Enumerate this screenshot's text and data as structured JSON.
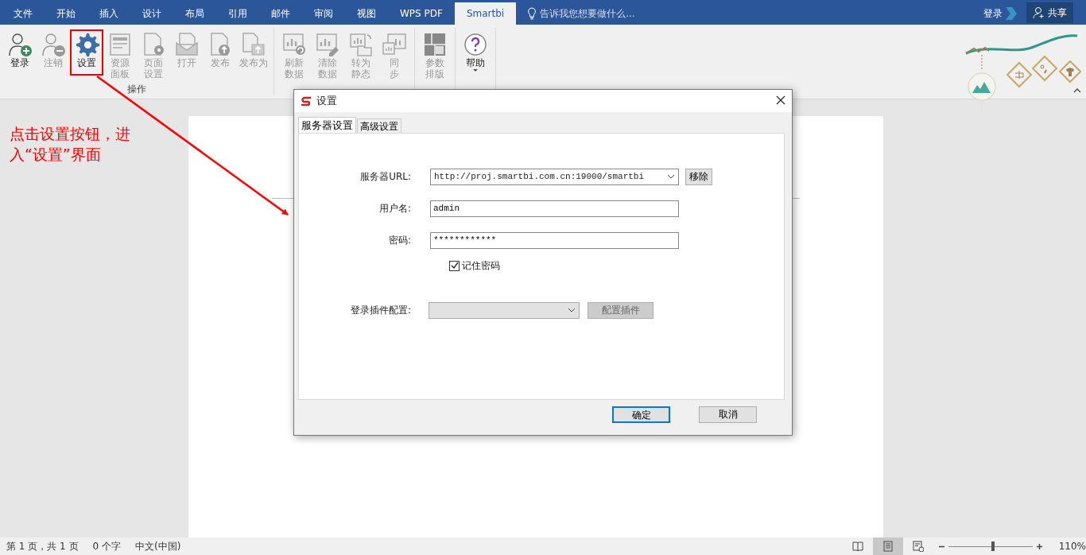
{
  "menu_tabs": [
    {
      "label": "文件",
      "selected": false
    },
    {
      "label": "开始",
      "selected": false
    },
    {
      "label": "插入",
      "selected": false
    },
    {
      "label": "设计",
      "selected": false
    },
    {
      "label": "布局",
      "selected": false
    },
    {
      "label": "引用",
      "selected": false
    },
    {
      "label": "邮件",
      "selected": false
    },
    {
      "label": "审阅",
      "selected": false
    },
    {
      "label": "视图",
      "selected": false
    },
    {
      "label": "WPS PDF",
      "selected": false
    },
    {
      "label": "Smartbi",
      "selected": true
    }
  ],
  "tell_me": {
    "placeholder": "告诉我您想要做什么..."
  },
  "account": {
    "login": "登录",
    "share": "共享"
  },
  "ribbon_groups": [
    {
      "label": "操作",
      "buttons": [
        {
          "kind": "user-add",
          "label": "登录",
          "disabled": false,
          "highlighted": false
        },
        {
          "kind": "user-remove",
          "label": "注销",
          "disabled": true,
          "highlighted": false
        },
        {
          "kind": "gear",
          "label": "设置",
          "disabled": false,
          "highlighted": true
        },
        {
          "kind": "panel",
          "label": [
            "资源",
            "面板"
          ],
          "disabled": true,
          "highlighted": false
        },
        {
          "kind": "page-gear",
          "label": [
            "页面",
            "设置"
          ],
          "disabled": true,
          "highlighted": false
        },
        {
          "kind": "envelope",
          "label": "打开",
          "disabled": true,
          "highlighted": false
        },
        {
          "kind": "upload",
          "label": "发布",
          "disabled": true,
          "highlighted": false
        },
        {
          "kind": "upload-copy",
          "label": "发布为",
          "disabled": true,
          "highlighted": false
        }
      ]
    },
    {
      "buttons": [
        {
          "kind": "chart-refresh",
          "label": [
            "刷新",
            "数据"
          ],
          "disabled": true,
          "highlighted": false
        },
        {
          "kind": "chart-erase",
          "label": [
            "清除",
            "数据"
          ],
          "disabled": true,
          "highlighted": false
        },
        {
          "kind": "chart-convert",
          "label": [
            "转为",
            "静态"
          ],
          "disabled": true,
          "highlighted": false
        },
        {
          "kind": "chart-sync",
          "label": [
            "同",
            "步"
          ],
          "disabled": true,
          "highlighted": false
        }
      ]
    },
    {
      "buttons": [
        {
          "kind": "layout",
          "label": [
            "参数",
            "排版"
          ],
          "disabled": true,
          "highlighted": false
        }
      ]
    },
    {
      "buttons": [
        {
          "kind": "help",
          "label": "帮助",
          "disabled": false,
          "highlighted": false,
          "dropdown": true
        }
      ]
    }
  ],
  "annotation": {
    "text": "点击设置按钮，进入“设置”界面"
  },
  "dialog": {
    "title": "设置",
    "tabs": [
      {
        "label": "服务器设置",
        "selected": true
      },
      {
        "label": "高级设置",
        "selected": false
      }
    ],
    "fields": [
      {
        "kind": "combo",
        "label": "服务器URL:",
        "value": "http://proj.smartbi.com.cn:19000/smartbi",
        "button": "移除",
        "disabled": false
      },
      {
        "kind": "text",
        "label": "用户名:",
        "value": "admin"
      },
      {
        "kind": "text",
        "label": "密码:",
        "value": "************"
      },
      {
        "kind": "checkbox",
        "label": "记住密码",
        "checked": true
      },
      {
        "kind": "combo",
        "label": "登录插件配置:",
        "button": "配置插件",
        "disabled": true
      }
    ],
    "buttons": [
      {
        "label": "确定",
        "default": true
      },
      {
        "label": "取消",
        "default": false
      }
    ]
  },
  "status_bar": {
    "items": [
      "第 1 页，共 1 页",
      "0 个字",
      "中文(中国)"
    ],
    "views": [
      {
        "kind": "read",
        "selected": false
      },
      {
        "kind": "print",
        "selected": true
      },
      {
        "kind": "web",
        "selected": false
      }
    ],
    "zoom": {
      "level": 0.51,
      "reading": "110%"
    }
  }
}
